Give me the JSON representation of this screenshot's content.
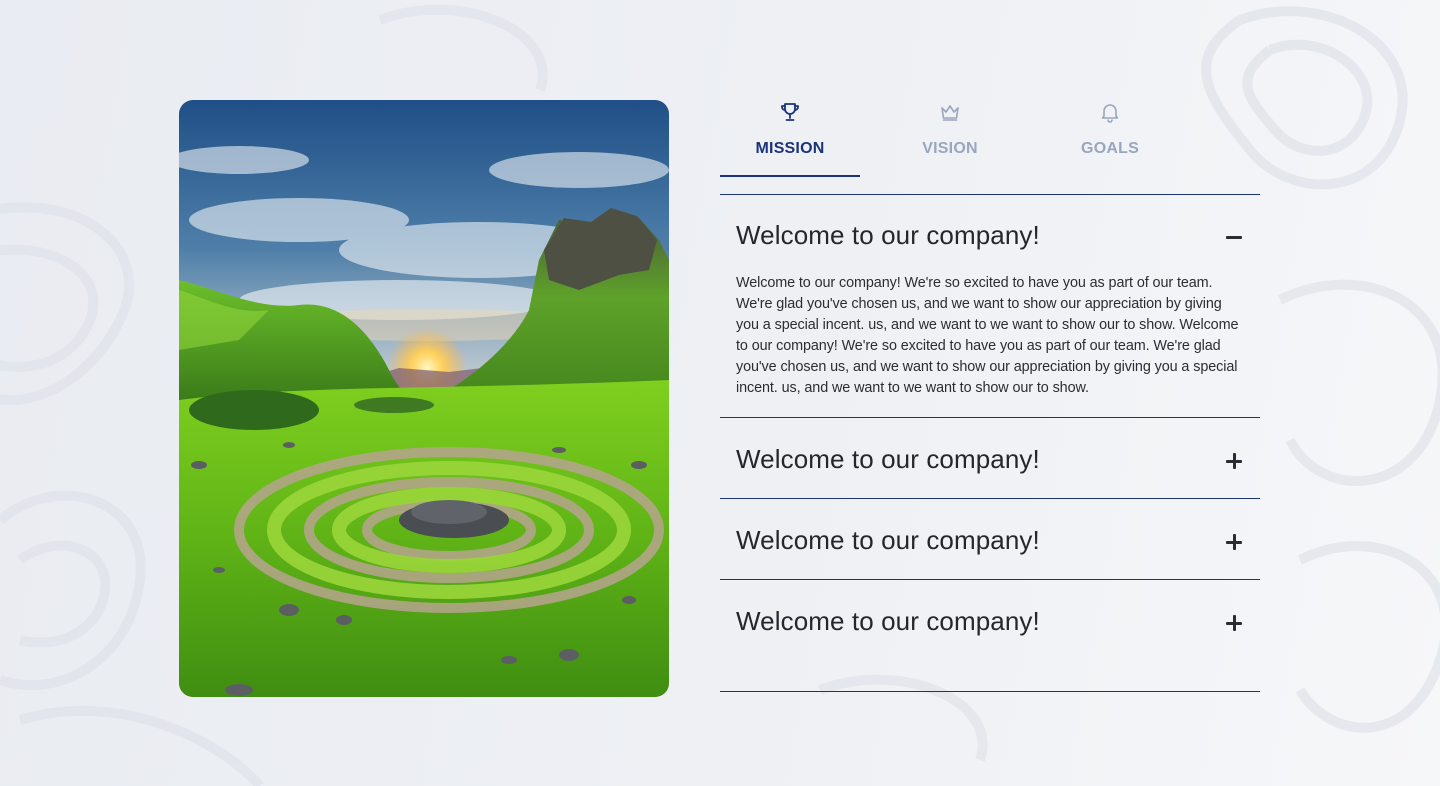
{
  "tabs": [
    {
      "label": "MISSION",
      "icon": "trophy-icon",
      "active": true
    },
    {
      "label": "VISION",
      "icon": "crown-icon",
      "active": false
    },
    {
      "label": "GOALS",
      "icon": "bell-icon",
      "active": false
    }
  ],
  "accordion": [
    {
      "title": "Welcome to our company!",
      "expanded": true,
      "body": "Welcome to our company! We're so excited to have you as part of our team. We're glad you've chosen us, and we want to show our appreciation by giving you a special incent. us, and we want to we want to show our to show. Welcome to our company! We're so excited to have you as part of our team. We're glad you've chosen us, and we want to show our appreciation by giving you a special incent. us, and we want to we want to show our to show."
    },
    {
      "title": "Welcome to our company!",
      "expanded": false
    },
    {
      "title": "Welcome to our company!",
      "expanded": false
    },
    {
      "title": "Welcome to our company!",
      "expanded": false
    }
  ],
  "colors": {
    "accent": "#1b3378",
    "inactive_tab": "#9aa6bf",
    "text": "#25272e",
    "background": "#eceef2"
  },
  "image": {
    "subject": "green meadow with stone spiral and sunset between hills"
  }
}
